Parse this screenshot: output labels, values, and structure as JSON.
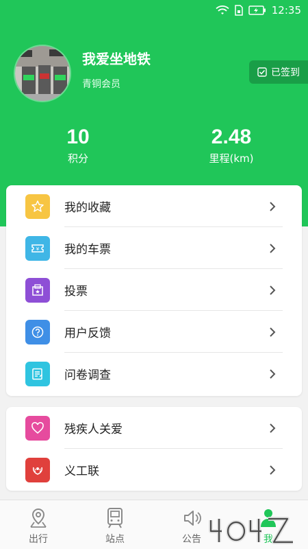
{
  "statusbar": {
    "time": "12:35",
    "icons": [
      "wifi-icon",
      "sim-card-icon",
      "battery-charging-icon"
    ]
  },
  "profile": {
    "name": "我爱坐地铁",
    "level": "青铜会员",
    "checkin_label": "已签到"
  },
  "stats": {
    "points_value": "10",
    "points_label": "积分",
    "mileage_value": "2.48",
    "mileage_label": "里程(km)"
  },
  "menu_main": [
    {
      "label": "我的收藏",
      "icon": "star-icon",
      "color": "#f7c543"
    },
    {
      "label": "我的车票",
      "icon": "ticket-icon",
      "color": "#3fb6e6"
    },
    {
      "label": "投票",
      "icon": "ballot-box-icon",
      "color": "#8e4fd6"
    },
    {
      "label": "用户反馈",
      "icon": "question-icon",
      "color": "#3f8fe6"
    },
    {
      "label": "问卷调查",
      "icon": "questionnaire-icon",
      "color": "#2fc4e0"
    }
  ],
  "menu_secondary": [
    {
      "label": "残疾人关爱",
      "icon": "heart-icon",
      "color": "#e64b9e"
    },
    {
      "label": "义工联",
      "icon": "volunteer-emblem-icon",
      "color": "#e0403c"
    }
  ],
  "tabbar": [
    {
      "label": "出行",
      "icon": "map-pin-icon",
      "active": false
    },
    {
      "label": "站点",
      "icon": "train-icon",
      "active": false
    },
    {
      "label": "公告",
      "icon": "speaker-icon",
      "active": false
    },
    {
      "label": "我",
      "icon": "person-icon",
      "active": true
    }
  ],
  "colors": {
    "brand": "#20c659",
    "brand_dark": "#199e47"
  }
}
